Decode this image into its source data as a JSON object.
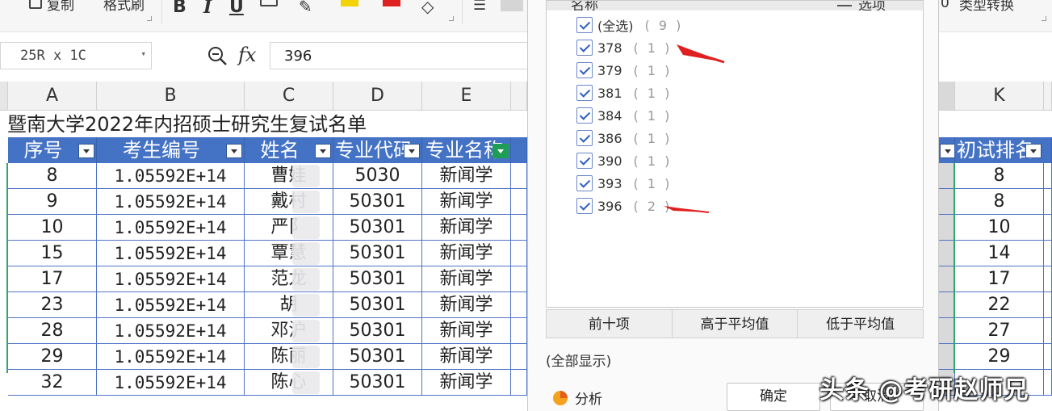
{
  "toolbar": {
    "copy_label": "复制",
    "format_painter_label": "格式刷",
    "convert_label": "类型转换",
    "ribbon_fragment": "0"
  },
  "formula_bar": {
    "name_box": "25R x 1C",
    "fx": "fx",
    "value": "396"
  },
  "columns": [
    "A",
    "B",
    "C",
    "D",
    "E",
    "K"
  ],
  "sheet": {
    "title": "暨南大学2022年内招硕士研究生复试名单",
    "headers": [
      "序号",
      "考生编号",
      "姓名",
      "专业代码",
      "专业名称",
      "初试排名"
    ],
    "rows": [
      {
        "seq": "8",
        "id": "1.05592E+14",
        "name": "曹娃",
        "code": "5030",
        "major": "新闻学",
        "rank": "8"
      },
      {
        "seq": "9",
        "id": "1.05592E+14",
        "name": "戴村",
        "code": "50301",
        "major": "新闻学",
        "rank": "8"
      },
      {
        "seq": "10",
        "id": "1.05592E+14",
        "name": "严阝",
        "code": "50301",
        "major": "新闻学",
        "rank": "10"
      },
      {
        "seq": "15",
        "id": "1.05592E+14",
        "name": "覃慧",
        "code": "50301",
        "major": "新闻学",
        "rank": "14"
      },
      {
        "seq": "17",
        "id": "1.05592E+14",
        "name": "范龙",
        "code": "50301",
        "major": "新闻学",
        "rank": "17"
      },
      {
        "seq": "23",
        "id": "1.05592E+14",
        "name": "胡",
        "code": "50301",
        "major": "新闻学",
        "rank": "22"
      },
      {
        "seq": "28",
        "id": "1.05592E+14",
        "name": "邓沪",
        "code": "50301",
        "major": "新闻学",
        "rank": "27"
      },
      {
        "seq": "29",
        "id": "1.05592E+14",
        "name": "陈丽",
        "code": "50301",
        "major": "新闻学",
        "rank": "29"
      },
      {
        "seq": "32",
        "id": "1.05592E+14",
        "name": "陈心",
        "code": "50301",
        "major": "新闻学",
        "rank": ""
      }
    ]
  },
  "filter_panel": {
    "list_header": "名称",
    "options_label": "选项",
    "items": [
      {
        "label": "(全选)",
        "count": "( 9 )"
      },
      {
        "label": "378",
        "count": "( 1 )"
      },
      {
        "label": "379",
        "count": "( 1 )"
      },
      {
        "label": "381",
        "count": "( 1 )"
      },
      {
        "label": "384",
        "count": "( 1 )"
      },
      {
        "label": "386",
        "count": "( 1 )"
      },
      {
        "label": "390",
        "count": "( 1 )"
      },
      {
        "label": "393",
        "count": "( 1 )"
      },
      {
        "label": "396",
        "count": "( 2 )"
      }
    ],
    "quick_buttons": [
      "前十项",
      "高于平均值",
      "低于平均值"
    ],
    "show_all": "(全部显示)",
    "analysis": "分析",
    "ok": "确定",
    "cancel": "取消"
  },
  "watermark": "头条 @考研赵师兄",
  "colors": {
    "header_blue": "#4472c4",
    "active_filter_green": "#1f9d55",
    "annotation_red": "#e02020"
  }
}
